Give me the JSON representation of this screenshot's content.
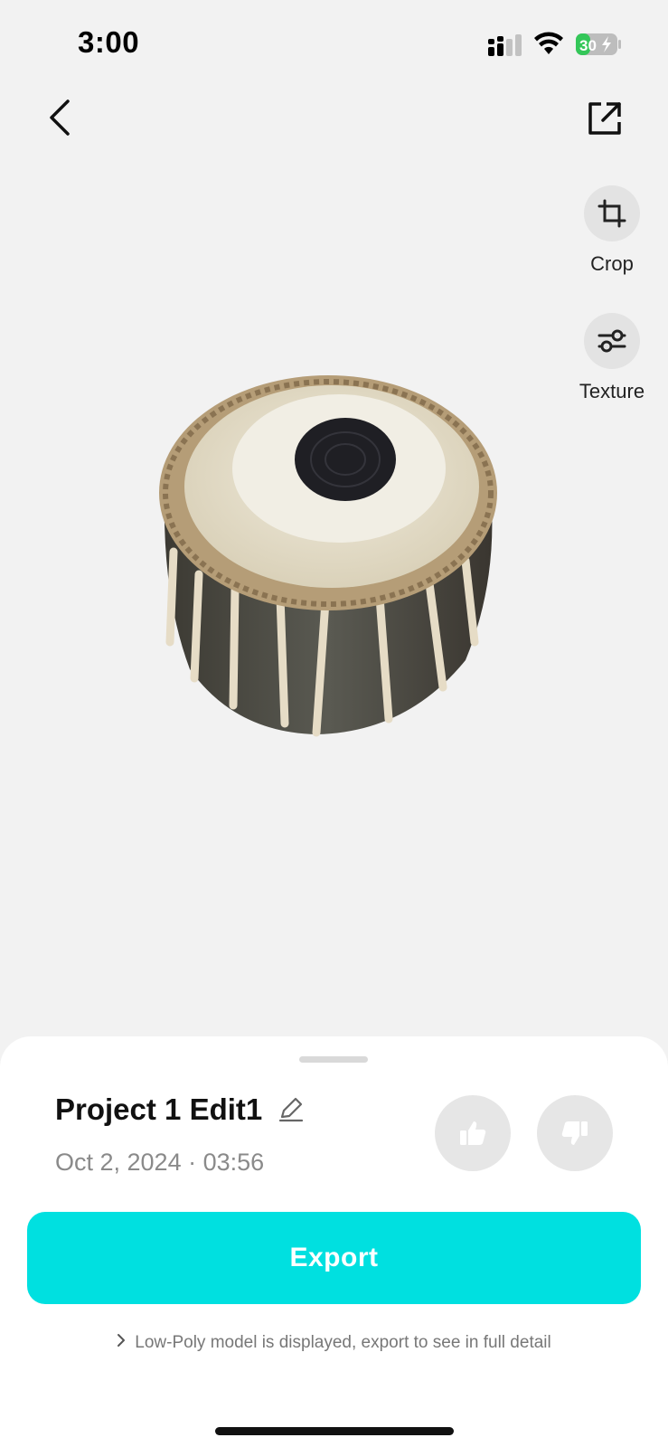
{
  "status_bar": {
    "time": "3:00",
    "battery": "30"
  },
  "tools": {
    "crop_label": "Crop",
    "texture_label": "Texture"
  },
  "project": {
    "title": "Project 1 Edit1",
    "date": "Oct 2, 2024 · 03:56"
  },
  "export_label": "Export",
  "notice": "Low-Poly model is displayed, export to see in full detail",
  "colors": {
    "accent": "#00e0e0",
    "battery_green": "#34c759"
  }
}
